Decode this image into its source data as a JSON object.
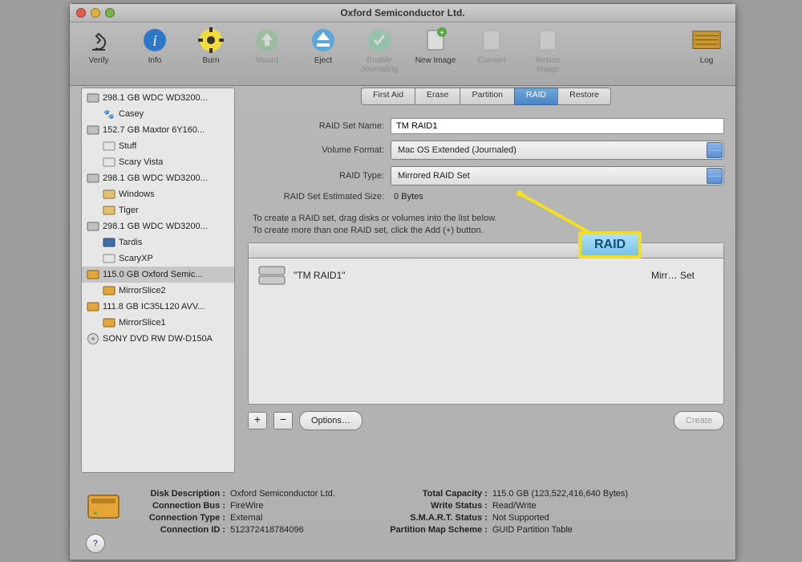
{
  "window": {
    "title": "Oxford Semiconductor Ltd."
  },
  "toolbar": {
    "verify": "Verify",
    "info": "Info",
    "burn": "Burn",
    "mount": "Mount",
    "eject": "Eject",
    "enableJournaling": "Enable Journaling",
    "newImage": "New Image",
    "convert": "Convert",
    "resizeImage": "Resize Image",
    "log": "Log"
  },
  "sidebar": [
    {
      "label": "298.1 GB WDC WD3200...",
      "children": [
        "Casey"
      ]
    },
    {
      "label": "152.7 GB Maxtor 6Y160...",
      "children": [
        "Stuff",
        "Scary Vista"
      ]
    },
    {
      "label": "298.1 GB WDC WD3200...",
      "children": [
        "Windows",
        "Tiger"
      ]
    },
    {
      "label": "298.1 GB WDC WD3200...",
      "children": [
        "Tardis",
        "ScaryXP"
      ]
    },
    {
      "label": "115.0 GB Oxford Semic...",
      "children": [
        "MirrorSlice2"
      ]
    },
    {
      "label": "111.8 GB IC35L120 AVV...",
      "children": [
        "MirrorSlice1"
      ]
    },
    {
      "label": "SONY DVD RW DW-D150A",
      "children": []
    }
  ],
  "tabs": [
    "First Aid",
    "Erase",
    "Partition",
    "RAID",
    "Restore"
  ],
  "raid": {
    "nameLabel": "RAID Set Name:",
    "nameValue": "TM RAID1",
    "formatLabel": "Volume Format:",
    "formatValue": "Mac OS Extended (Journaled)",
    "typeLabel": "RAID Type:",
    "typeValue": "Mirrored RAID Set",
    "sizeLabel": "RAID Set Estimated Size:",
    "sizeValue": "0 Bytes",
    "instructions1": "To create a RAID set, drag disks or volumes into the list below.",
    "instructions2": "To create more than one RAID set, click the Add (+) button.",
    "member": {
      "name": "\"TM RAID1\"",
      "kind": "Mirr… Set"
    }
  },
  "buttons": {
    "plus": "+",
    "minus": "−",
    "options": "Options…",
    "create": "Create"
  },
  "footer": {
    "left": [
      {
        "k": "Disk Description :",
        "v": "Oxford Semiconductor Ltd."
      },
      {
        "k": "Connection Bus :",
        "v": "FireWire"
      },
      {
        "k": "Connection Type :",
        "v": "External"
      },
      {
        "k": "Connection ID :",
        "v": "512372418784096"
      }
    ],
    "right": [
      {
        "k": "Total Capacity :",
        "v": "115.0 GB (123,522,416,640 Bytes)"
      },
      {
        "k": "Write Status :",
        "v": "Read/Write"
      },
      {
        "k": "S.M.A.R.T. Status :",
        "v": "Not Supported"
      },
      {
        "k": "Partition Map Scheme :",
        "v": "GUID Partition Table"
      }
    ]
  },
  "annotation": {
    "raid": "RAID"
  }
}
